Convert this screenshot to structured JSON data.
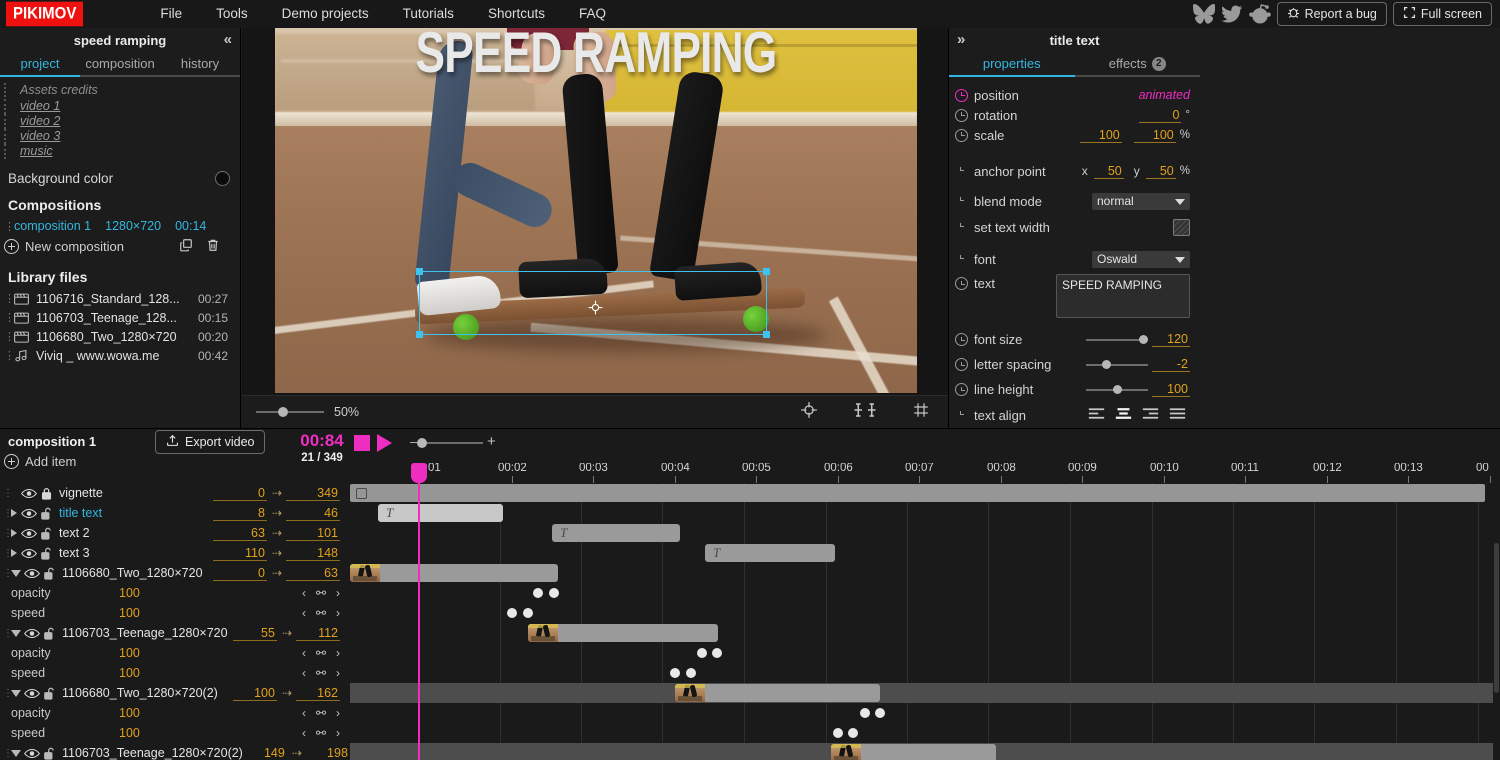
{
  "app": {
    "logo": "PIKIMOV"
  },
  "menubar": {
    "items": [
      "File",
      "Tools",
      "Demo projects",
      "Tutorials",
      "Shortcuts",
      "FAQ"
    ],
    "social": [
      "bluesky-icon",
      "twitter-icon",
      "reddit-icon"
    ],
    "report_bug": "Report a bug",
    "full_screen": "Full screen"
  },
  "left_panel": {
    "title": "speed ramping",
    "collapse_icon": "«",
    "tabs": [
      {
        "label": "project",
        "active": true
      },
      {
        "label": "composition",
        "active": false
      },
      {
        "label": "history",
        "active": false
      }
    ],
    "assets_credits_label": "Assets credits",
    "credits": [
      "video 1",
      "video 2",
      "video 3",
      "music"
    ],
    "background_color_label": "Background color",
    "background_color": "#0b0b0b",
    "compositions_heading": "Compositions",
    "compositions": [
      {
        "name": "composition 1",
        "dimensions": "1280×720",
        "duration": "00:14"
      }
    ],
    "new_composition_label": "New composition",
    "library_heading": "Library files",
    "library_files": [
      {
        "icon": "video-file-icon",
        "name": "1106716_Standard_128...",
        "duration": "00:27"
      },
      {
        "icon": "video-file-icon",
        "name": "1106703_Teenage_128...",
        "duration": "00:15"
      },
      {
        "icon": "video-file-icon",
        "name": "1106680_Two_1280×720",
        "duration": "00:20"
      },
      {
        "icon": "audio-file-icon",
        "name": "Viviq _ www.wowa.me",
        "duration": "00:42"
      }
    ]
  },
  "canvas": {
    "overlay_text": "SPEED RAMPING",
    "zoom_percent": "50%",
    "tools": [
      "anchor-point-tool",
      "align-tool",
      "grid-tool"
    ]
  },
  "right_panel": {
    "title": "title text",
    "expand_icon": "»",
    "tabs": [
      {
        "label": "properties",
        "badge": "",
        "active": true
      },
      {
        "label": "effects",
        "badge": "2",
        "active": false
      }
    ],
    "position": {
      "label": "position",
      "value": "animated",
      "keyframed": true
    },
    "rotation": {
      "label": "rotation",
      "value": "0",
      "unit": "°"
    },
    "scale": {
      "label": "scale",
      "x": "100",
      "y": "100",
      "unit": "%"
    },
    "anchor_point": {
      "label": "anchor point",
      "x_label": "x",
      "x": "50",
      "y_label": "y",
      "y": "50",
      "unit": "%"
    },
    "blend_mode": {
      "label": "blend mode",
      "value": "normal"
    },
    "set_text_width": {
      "label": "set text width",
      "checked": false
    },
    "font": {
      "label": "font",
      "value": "Oswald"
    },
    "text": {
      "label": "text",
      "value": "SPEED RAMPING"
    },
    "font_size": {
      "label": "font size",
      "value": "120"
    },
    "letter_spacing": {
      "label": "letter spacing",
      "value": "-2"
    },
    "line_height": {
      "label": "line height",
      "value": "100"
    },
    "text_align": {
      "label": "text align",
      "options": [
        "left",
        "center",
        "right",
        "justify"
      ],
      "selected": "center"
    }
  },
  "timeline": {
    "composition_name": "composition 1",
    "add_item_label": "Add item",
    "export_label": "Export video",
    "current_time": "00:84",
    "frame_counter": "21 / 349",
    "ruler_labels": [
      "00:01",
      "00:02",
      "00:03",
      "00:04",
      "00:05",
      "00:06",
      "00:07",
      "00:08",
      "00:09",
      "00:10",
      "00:11",
      "00:12",
      "00:13",
      "00"
    ],
    "layers": [
      {
        "name": "vignette",
        "selected": false,
        "expandable": false,
        "expanded": false,
        "locked": true,
        "start": "0",
        "end": "349",
        "sub": []
      },
      {
        "name": "title text",
        "selected": true,
        "expandable": true,
        "expanded": false,
        "locked": false,
        "start": "8",
        "end": "46",
        "sub": []
      },
      {
        "name": "text 2",
        "selected": false,
        "expandable": true,
        "expanded": false,
        "locked": false,
        "start": "63",
        "end": "101",
        "sub": []
      },
      {
        "name": "text 3",
        "selected": false,
        "expandable": true,
        "expanded": false,
        "locked": false,
        "start": "110",
        "end": "148",
        "sub": []
      },
      {
        "name": "1106680_Two_1280×720",
        "selected": false,
        "expandable": true,
        "expanded": true,
        "locked": false,
        "start": "0",
        "end": "63",
        "sub": [
          {
            "name": "opacity",
            "value": "100"
          },
          {
            "name": "speed",
            "value": "100"
          }
        ]
      },
      {
        "name": "1106703_Teenage_1280×720",
        "selected": false,
        "expandable": true,
        "expanded": true,
        "locked": false,
        "start": "55",
        "end": "112",
        "sub": [
          {
            "name": "opacity",
            "value": "100"
          },
          {
            "name": "speed",
            "value": "100"
          }
        ]
      },
      {
        "name": "1106680_Two_1280×720(2)",
        "selected": false,
        "expandable": true,
        "expanded": true,
        "locked": false,
        "start": "100",
        "end": "162",
        "sub": [
          {
            "name": "opacity",
            "value": "100"
          },
          {
            "name": "speed",
            "value": "100"
          }
        ]
      },
      {
        "name": "1106703_Teenage_1280×720(2)",
        "selected": false,
        "expandable": true,
        "expanded": true,
        "locked": false,
        "start": "149",
        "end": "198",
        "sub": []
      }
    ]
  }
}
